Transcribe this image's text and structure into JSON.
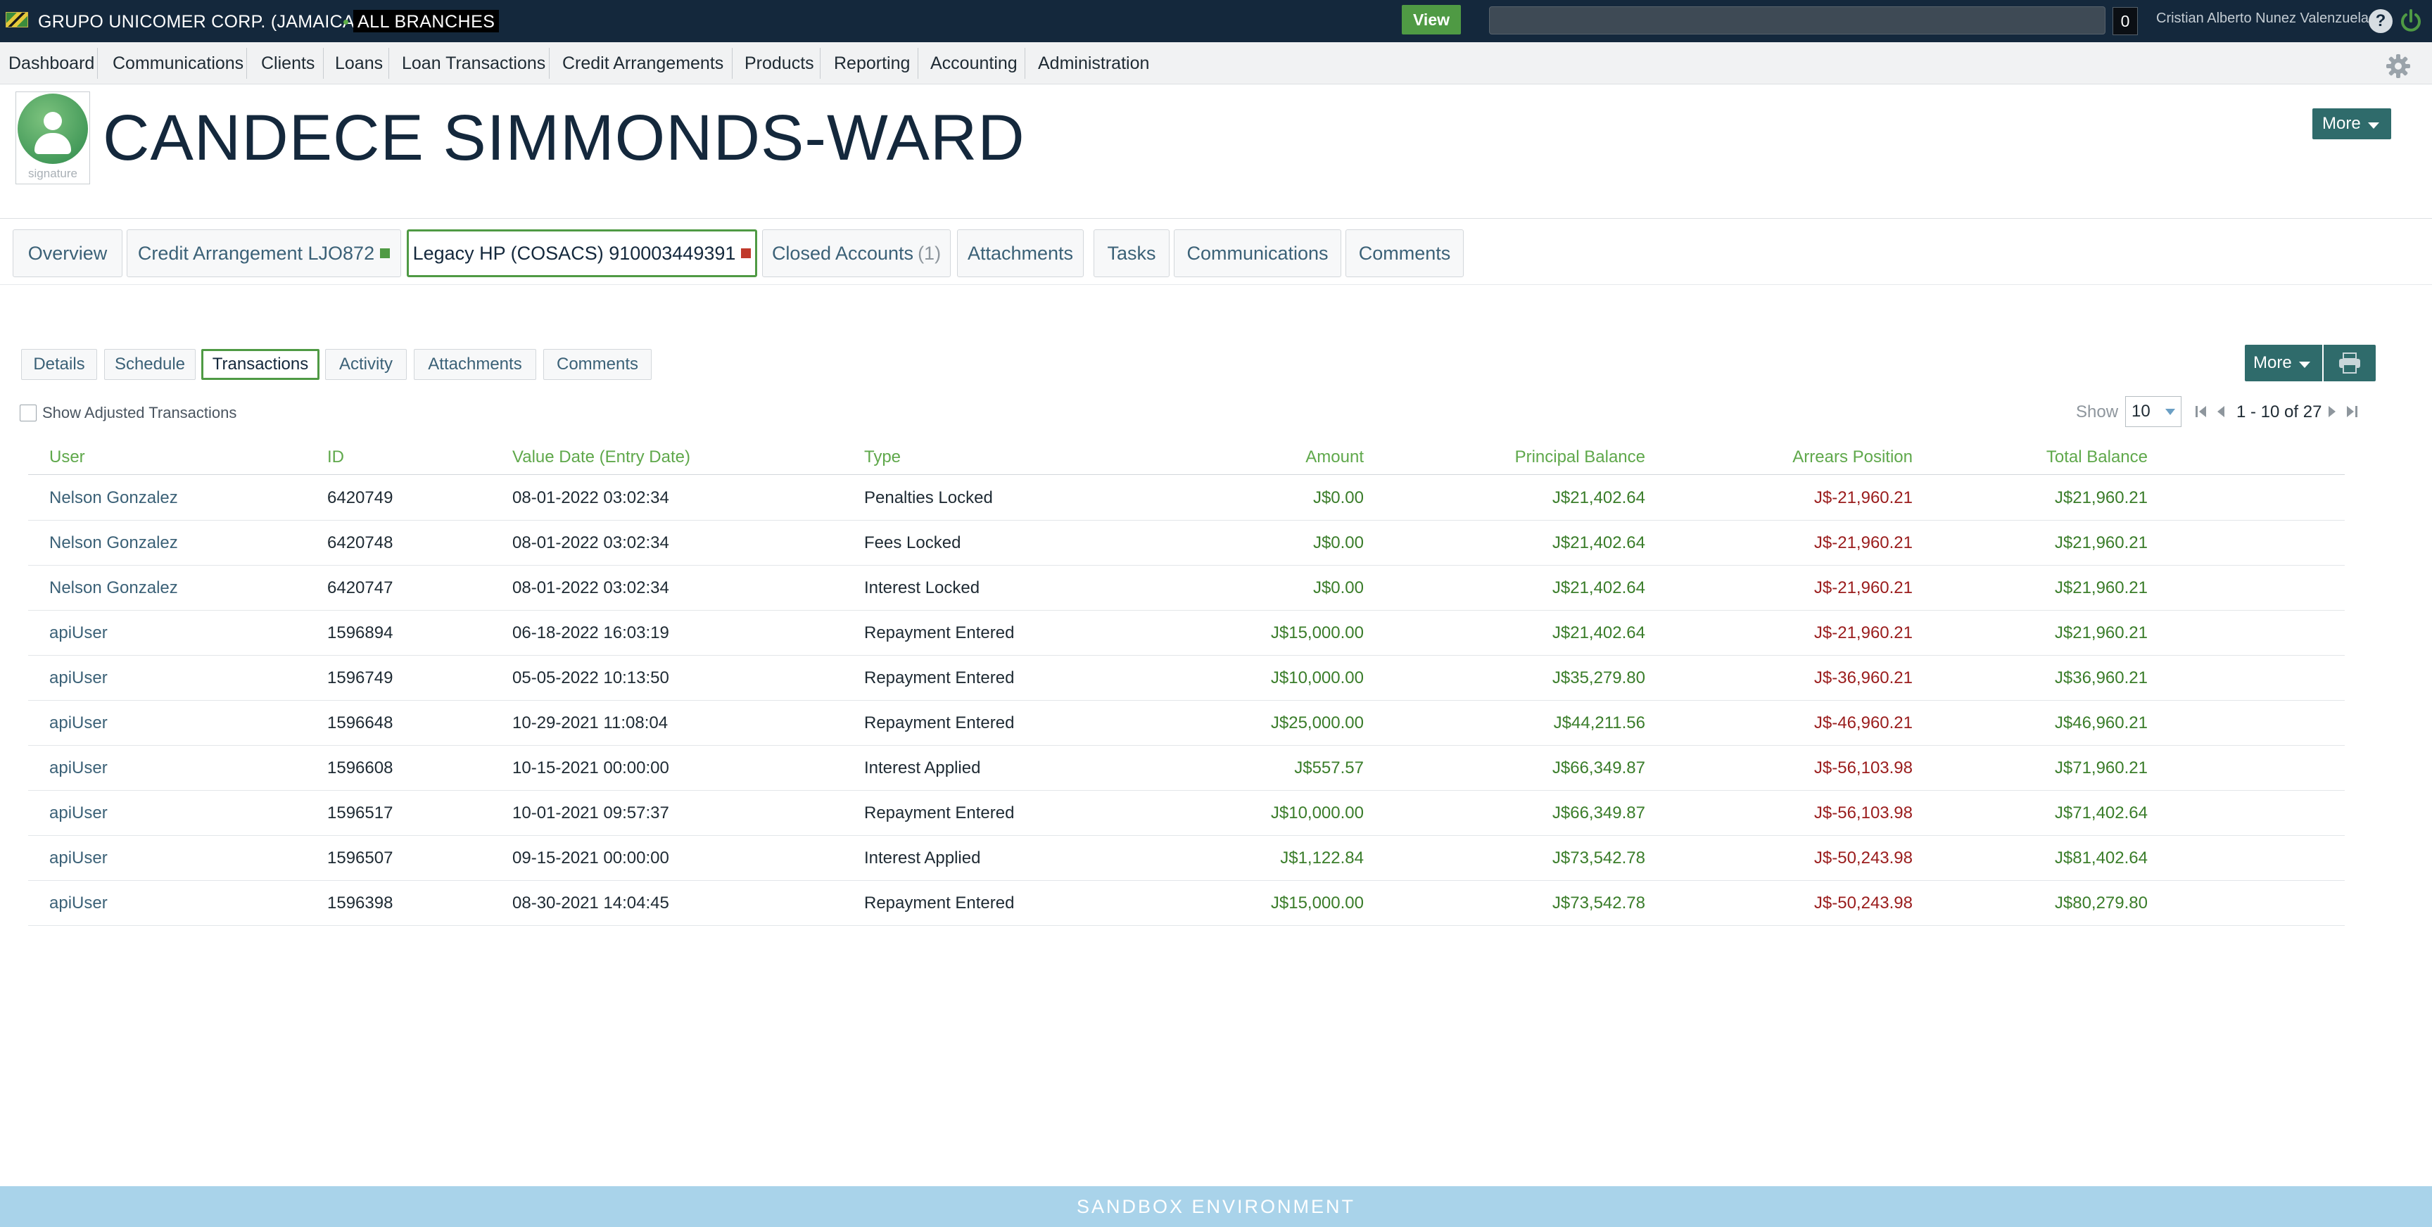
{
  "topbar": {
    "company": "GRUPO UNICOMER CORP. (JAMAICA)",
    "branches": "ALL BRANCHES",
    "view_label": "View",
    "search_placeholder": "",
    "search_count": "0",
    "user_name": "Cristian Alberto Nunez Valenzuela",
    "help_label": "?"
  },
  "nav": {
    "items": [
      "Dashboard",
      "Communications",
      "Clients",
      "Loans",
      "Loan Transactions",
      "Credit Arrangements",
      "Products",
      "Reporting",
      "Accounting",
      "Administration"
    ]
  },
  "header": {
    "signature_label": "signature",
    "client_name": "CANDECE SIMMONDS-WARD",
    "more_label": "More"
  },
  "tabs": [
    {
      "label": "Overview"
    },
    {
      "label": "Credit Arrangement LJO872",
      "status_color": "#4f9a44"
    },
    {
      "label": "Legacy HP (COSACS) 910003449391",
      "status_color": "#c0392b"
    },
    {
      "label": "Closed Accounts",
      "count": "(1)"
    },
    {
      "label": "Attachments"
    },
    {
      "label": "Tasks"
    },
    {
      "label": "Communications"
    },
    {
      "label": "Comments"
    }
  ],
  "subtabs": [
    "Details",
    "Schedule",
    "Transactions",
    "Activity",
    "Attachments",
    "Comments"
  ],
  "actions": {
    "more_label": "More"
  },
  "filters": {
    "show_adjusted_label": "Show Adjusted Transactions",
    "show_label": "Show",
    "page_size": "10",
    "pagination_text": "1 - 10 of 27"
  },
  "table": {
    "columns": [
      "User",
      "ID",
      "Value Date (Entry Date)",
      "Type",
      "Amount",
      "Principal Balance",
      "Arrears Position",
      "Total Balance"
    ],
    "rows": [
      {
        "user": "Nelson Gonzalez",
        "id": "6420749",
        "date": "08-01-2022 03:02:34",
        "type": "Penalties Locked",
        "amount": "J$0.00",
        "principal": "J$21,402.64",
        "arrears": "J$-21,960.21",
        "total": "J$21,960.21"
      },
      {
        "user": "Nelson Gonzalez",
        "id": "6420748",
        "date": "08-01-2022 03:02:34",
        "type": "Fees Locked",
        "amount": "J$0.00",
        "principal": "J$21,402.64",
        "arrears": "J$-21,960.21",
        "total": "J$21,960.21"
      },
      {
        "user": "Nelson Gonzalez",
        "id": "6420747",
        "date": "08-01-2022 03:02:34",
        "type": "Interest Locked",
        "amount": "J$0.00",
        "principal": "J$21,402.64",
        "arrears": "J$-21,960.21",
        "total": "J$21,960.21"
      },
      {
        "user": "apiUser",
        "id": "1596894",
        "date": "06-18-2022 16:03:19",
        "type": "Repayment Entered",
        "amount": "J$15,000.00",
        "principal": "J$21,402.64",
        "arrears": "J$-21,960.21",
        "total": "J$21,960.21"
      },
      {
        "user": "apiUser",
        "id": "1596749",
        "date": "05-05-2022 10:13:50",
        "type": "Repayment Entered",
        "amount": "J$10,000.00",
        "principal": "J$35,279.80",
        "arrears": "J$-36,960.21",
        "total": "J$36,960.21"
      },
      {
        "user": "apiUser",
        "id": "1596648",
        "date": "10-29-2021 11:08:04",
        "type": "Repayment Entered",
        "amount": "J$25,000.00",
        "principal": "J$44,211.56",
        "arrears": "J$-46,960.21",
        "total": "J$46,960.21"
      },
      {
        "user": "apiUser",
        "id": "1596608",
        "date": "10-15-2021 00:00:00",
        "type": "Interest Applied",
        "amount": "J$557.57",
        "principal": "J$66,349.87",
        "arrears": "J$-56,103.98",
        "total": "J$71,960.21"
      },
      {
        "user": "apiUser",
        "id": "1596517",
        "date": "10-01-2021 09:57:37",
        "type": "Repayment Entered",
        "amount": "J$10,000.00",
        "principal": "J$66,349.87",
        "arrears": "J$-56,103.98",
        "total": "J$71,402.64"
      },
      {
        "user": "apiUser",
        "id": "1596507",
        "date": "09-15-2021 00:00:00",
        "type": "Interest Applied",
        "amount": "J$1,122.84",
        "principal": "J$73,542.78",
        "arrears": "J$-50,243.98",
        "total": "J$81,402.64"
      },
      {
        "user": "apiUser",
        "id": "1596398",
        "date": "08-30-2021 14:04:45",
        "type": "Repayment Entered",
        "amount": "J$15,000.00",
        "principal": "J$73,542.78",
        "arrears": "J$-50,243.98",
        "total": "J$80,279.80"
      }
    ]
  },
  "footer": {
    "label": "SANDBOX ENVIRONMENT"
  },
  "colors": {
    "topbar": "#14283c",
    "accent_green": "#4f9a44",
    "teal_button": "#2f6b6b",
    "positive_amount": "#3a7d2a",
    "negative_amount": "#9a1c1c",
    "footer": "#a9d3ea"
  },
  "icons": [
    "flag-icon",
    "help-icon",
    "power-icon",
    "gear-icon",
    "user-avatar-icon",
    "printer-icon",
    "first-page-icon",
    "prev-page-icon",
    "next-page-icon",
    "last-page-icon"
  ]
}
